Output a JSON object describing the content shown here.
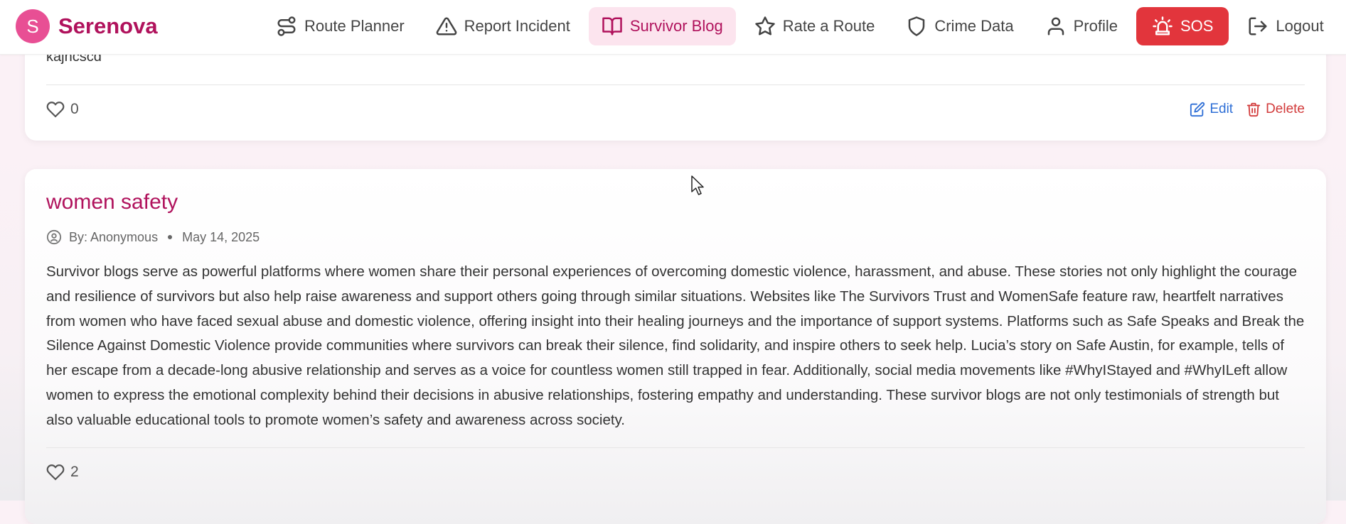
{
  "brand": {
    "initial": "S",
    "name": "Serenova"
  },
  "nav": {
    "items": [
      {
        "label": "Route Planner",
        "icon": "route-icon"
      },
      {
        "label": "Report Incident",
        "icon": "alert-triangle-icon"
      },
      {
        "label": "Survivor Blog",
        "icon": "book-open-icon",
        "active": true
      },
      {
        "label": "Rate a Route",
        "icon": "star-icon"
      },
      {
        "label": "Crime Data",
        "icon": "shield-icon"
      },
      {
        "label": "Profile",
        "icon": "user-icon"
      },
      {
        "label": "SOS",
        "icon": "siren-icon"
      },
      {
        "label": "Logout",
        "icon": "logout-icon"
      }
    ],
    "colors": {
      "accent": "#b0125c",
      "active_bg": "#fce4ee",
      "sos_bg": "#e2353c"
    }
  },
  "posts": [
    {
      "partial_text": "kajncscd",
      "likes": "0",
      "edit_label": "Edit",
      "delete_label": "Delete"
    },
    {
      "title": "women safety",
      "author": "By: Anonymous",
      "date": "May 14, 2025",
      "body": "Survivor blogs serve as powerful platforms where women share their personal experiences of overcoming domestic violence, harassment, and abuse. These stories not only highlight the courage and resilience of survivors but also help raise awareness and support others going through similar situations. Websites like The Survivors Trust and WomenSafe feature raw, heartfelt narratives from women who have faced sexual abuse and domestic violence, offering insight into their healing journeys and the importance of support systems. Platforms such as Safe Speaks and Break the Silence Against Domestic Violence provide communities where survivors can break their silence, find solidarity, and inspire others to seek help. Lucia’s story on Safe Austin, for example, tells of her escape from a decade-long abusive relationship and serves as a voice for countless women still trapped in fear. Additionally, social media movements like #WhyIStayed and #WhyILeft allow women to express the emotional complexity behind their decisions in abusive relationships, fostering empathy and understanding. These survivor blogs are not only testimonials of strength but also valuable educational tools to promote women’s safety and awareness across society.",
      "likes": "2"
    }
  ]
}
